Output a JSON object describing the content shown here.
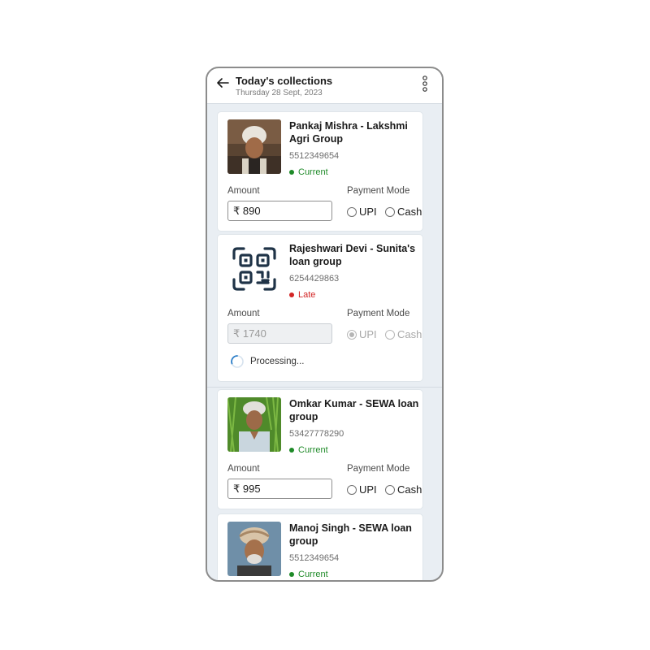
{
  "header": {
    "title": "Today's collections",
    "date": "Thursday 28 Sept, 2023",
    "back_icon": "arrow-left-icon",
    "menu_icon": "more-vertical-icon"
  },
  "labels": {
    "amount": "Amount",
    "payment_mode": "Payment Mode",
    "upi": "UPI",
    "cash": "Cash",
    "processing": "Processing..."
  },
  "colors": {
    "current": "#1e8a28",
    "late": "#d32525"
  },
  "collections": [
    {
      "name": "Pankaj Mishra - Lakshmi Agri Group",
      "phone": "5512349654",
      "status": "Current",
      "amount": "₹ 890",
      "payment_mode": "",
      "avatar": "photo"
    },
    {
      "name": "Rajeshwari Devi - Sunita's loan group",
      "phone": "6254429863",
      "status": "Late",
      "amount": "₹ 1740",
      "payment_mode": "UPI",
      "avatar": "qr-code-icon",
      "processing": true
    },
    {
      "name": "Omkar Kumar - SEWA loan group",
      "phone": "53427778290",
      "status": "Current",
      "amount": "₹ 995",
      "payment_mode": "",
      "avatar": "photo"
    },
    {
      "name": "Manoj Singh - SEWA loan group",
      "phone": "5512349654",
      "status": "Current",
      "avatar": "photo"
    }
  ]
}
